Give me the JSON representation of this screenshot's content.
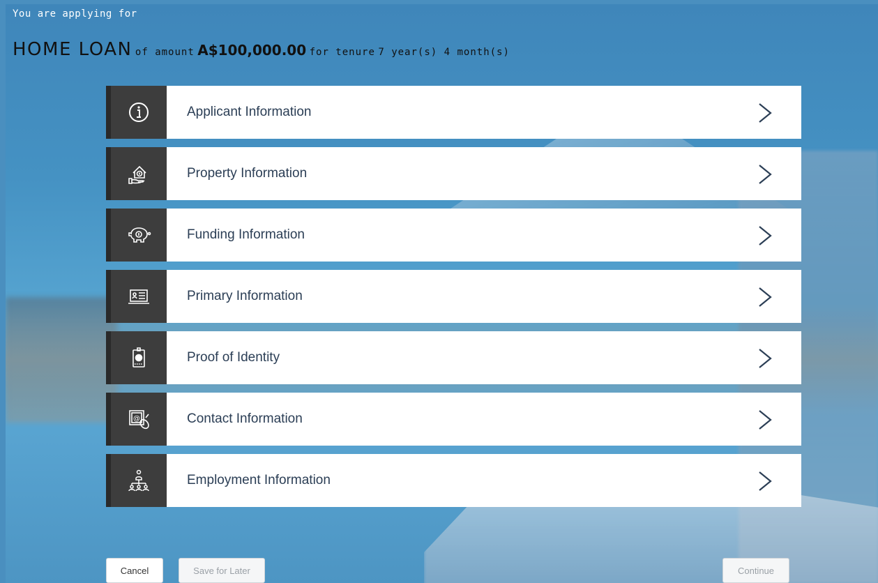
{
  "header": {
    "intro": "You are applying for",
    "product": "HOME LOAN",
    "of_amount": "of amount",
    "amount": "A$100,000.00",
    "for_tenure": "for tenure",
    "tenure": "7 year(s) 4 month(s)"
  },
  "sections": [
    {
      "label": "Applicant Information",
      "icon": "info-icon"
    },
    {
      "label": "Property Information",
      "icon": "house-hand-icon"
    },
    {
      "label": "Funding Information",
      "icon": "piggy-bank-icon"
    },
    {
      "label": "Primary Information",
      "icon": "id-card-laptop-icon"
    },
    {
      "label": "Proof of Identity",
      "icon": "id-badge-icon"
    },
    {
      "label": "Contact Information",
      "icon": "email-mouse-icon"
    },
    {
      "label": "Employment Information",
      "icon": "org-people-icon"
    }
  ],
  "buttons": {
    "cancel": "Cancel",
    "save_for_later": "Save for Later",
    "continue": "Continue"
  },
  "colors": {
    "icon_panel": "#3d3d3d",
    "label_text": "#2b3e55",
    "background": "#4a8fbf"
  }
}
